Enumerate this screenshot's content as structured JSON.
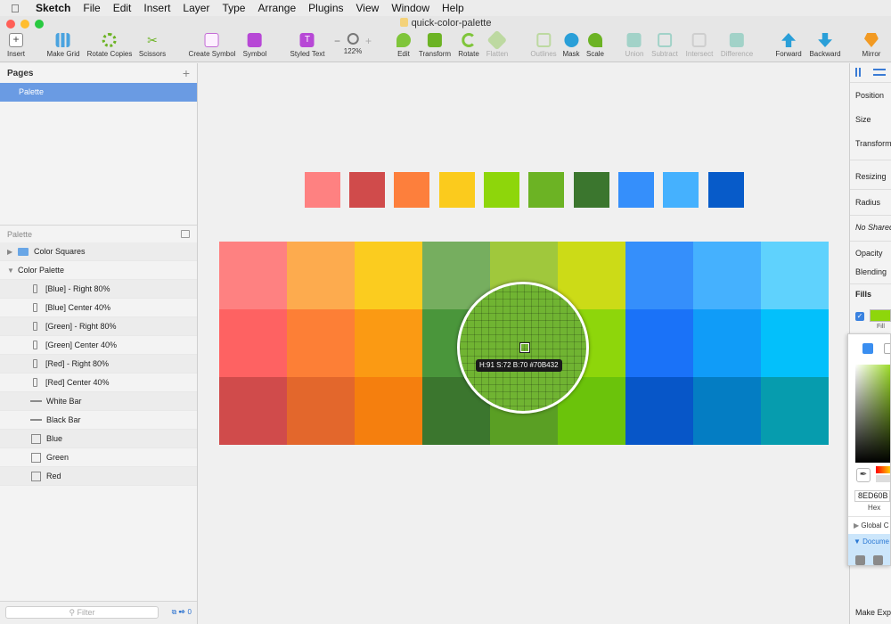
{
  "menubar": {
    "apple_icon": "apple-icon",
    "items": [
      "Sketch",
      "File",
      "Edit",
      "Insert",
      "Layer",
      "Type",
      "Arrange",
      "Plugins",
      "View",
      "Window",
      "Help"
    ]
  },
  "window": {
    "title": "quick-color-palette",
    "traffic_lights": [
      "#ff5f57",
      "#ffbd2e",
      "#28c940"
    ]
  },
  "toolbar": {
    "insert": "Insert",
    "make_grid": "Make Grid",
    "rotate_copies": "Rotate Copies",
    "scissors": "Scissors",
    "create_symbol": "Create Symbol",
    "symbol": "Symbol",
    "styled_text": "Styled Text",
    "zoom": "122%",
    "zoom_minus": "−",
    "zoom_plus": "+",
    "edit": "Edit",
    "transform": "Transform",
    "rotate": "Rotate",
    "flatten": "Flatten",
    "outlines": "Outlines",
    "mask": "Mask",
    "scale": "Scale",
    "union": "Union",
    "subtract": "Subtract",
    "intersect": "Intersect",
    "difference": "Difference",
    "forward": "Forward",
    "backward": "Backward",
    "mirror": "Mirror"
  },
  "pages": {
    "header": "Pages",
    "add": "+",
    "items": [
      "Palette"
    ]
  },
  "layers": {
    "header": "Palette",
    "items": [
      {
        "label": "Color Squares",
        "type": "folder"
      },
      {
        "label": "Color Palette",
        "type": "group"
      },
      {
        "label": "[Blue] - Right 80%",
        "type": "rect"
      },
      {
        "label": "[Blue] Center 40%",
        "type": "rect"
      },
      {
        "label": "[Green] - Right 80%",
        "type": "rect"
      },
      {
        "label": "[Green] Center 40%",
        "type": "rect"
      },
      {
        "label": "[Red] - Right 80%",
        "type": "rect"
      },
      {
        "label": "[Red] Center 40%",
        "type": "rect"
      },
      {
        "label": "White Bar",
        "type": "line"
      },
      {
        "label": "Black Bar",
        "type": "line"
      },
      {
        "label": "Blue",
        "type": "square"
      },
      {
        "label": "Green",
        "type": "square"
      },
      {
        "label": "Red",
        "type": "square"
      }
    ],
    "filter_placeholder": "Filter",
    "footer_count": "0"
  },
  "canvas": {
    "swatches": [
      "#fe8181",
      "#d04b4b",
      "#fd7f3c",
      "#fbcb1d",
      "#8ed60b",
      "#6cb324",
      "#3b762e",
      "#358ffb",
      "#45b1fe",
      "#075bc9"
    ],
    "grid_rows": [
      [
        "#fe8181",
        "#fdab4e",
        "#fbcc1f",
        "#76ae5f",
        "#a0c83c",
        "#ccdb17",
        "#358ffb",
        "#45b1fe",
        "#5fd2fd"
      ],
      [
        "#fe6262",
        "#fd7f36",
        "#fb9a13",
        "#4a963b",
        "#70b432",
        "#8ed60b",
        "#1a72f8",
        "#109cf8",
        "#03c0fb"
      ],
      [
        "#d04b4b",
        "#e3672c",
        "#f57f0e",
        "#3b762e",
        "#5a9f24",
        "#6bc30b",
        "#0756c8",
        "#047dc3",
        "#069cae"
      ]
    ],
    "loupe_label": "H:91 S:72 B:70 #70B432"
  },
  "inspector": {
    "position": "Position",
    "size": "Size",
    "transform": "Transform",
    "resizing": "Resizing",
    "radius": "Radius",
    "shared_style": "No Shared",
    "opacity": "Opacity",
    "blending": "Blending",
    "fills": "Fills",
    "fill_label": "Fill",
    "fill_color": "#8ed60b",
    "make_exportable": "Make Exp"
  },
  "color_popover": {
    "hex_value": "8ED60B",
    "hex_label": "Hex",
    "global_colors": "Global C",
    "document_colors": "Docume",
    "document_swatches": [
      "#8a8a8a",
      "#8a8a8a",
      "#1e9af0",
      "#1e9af0"
    ]
  }
}
